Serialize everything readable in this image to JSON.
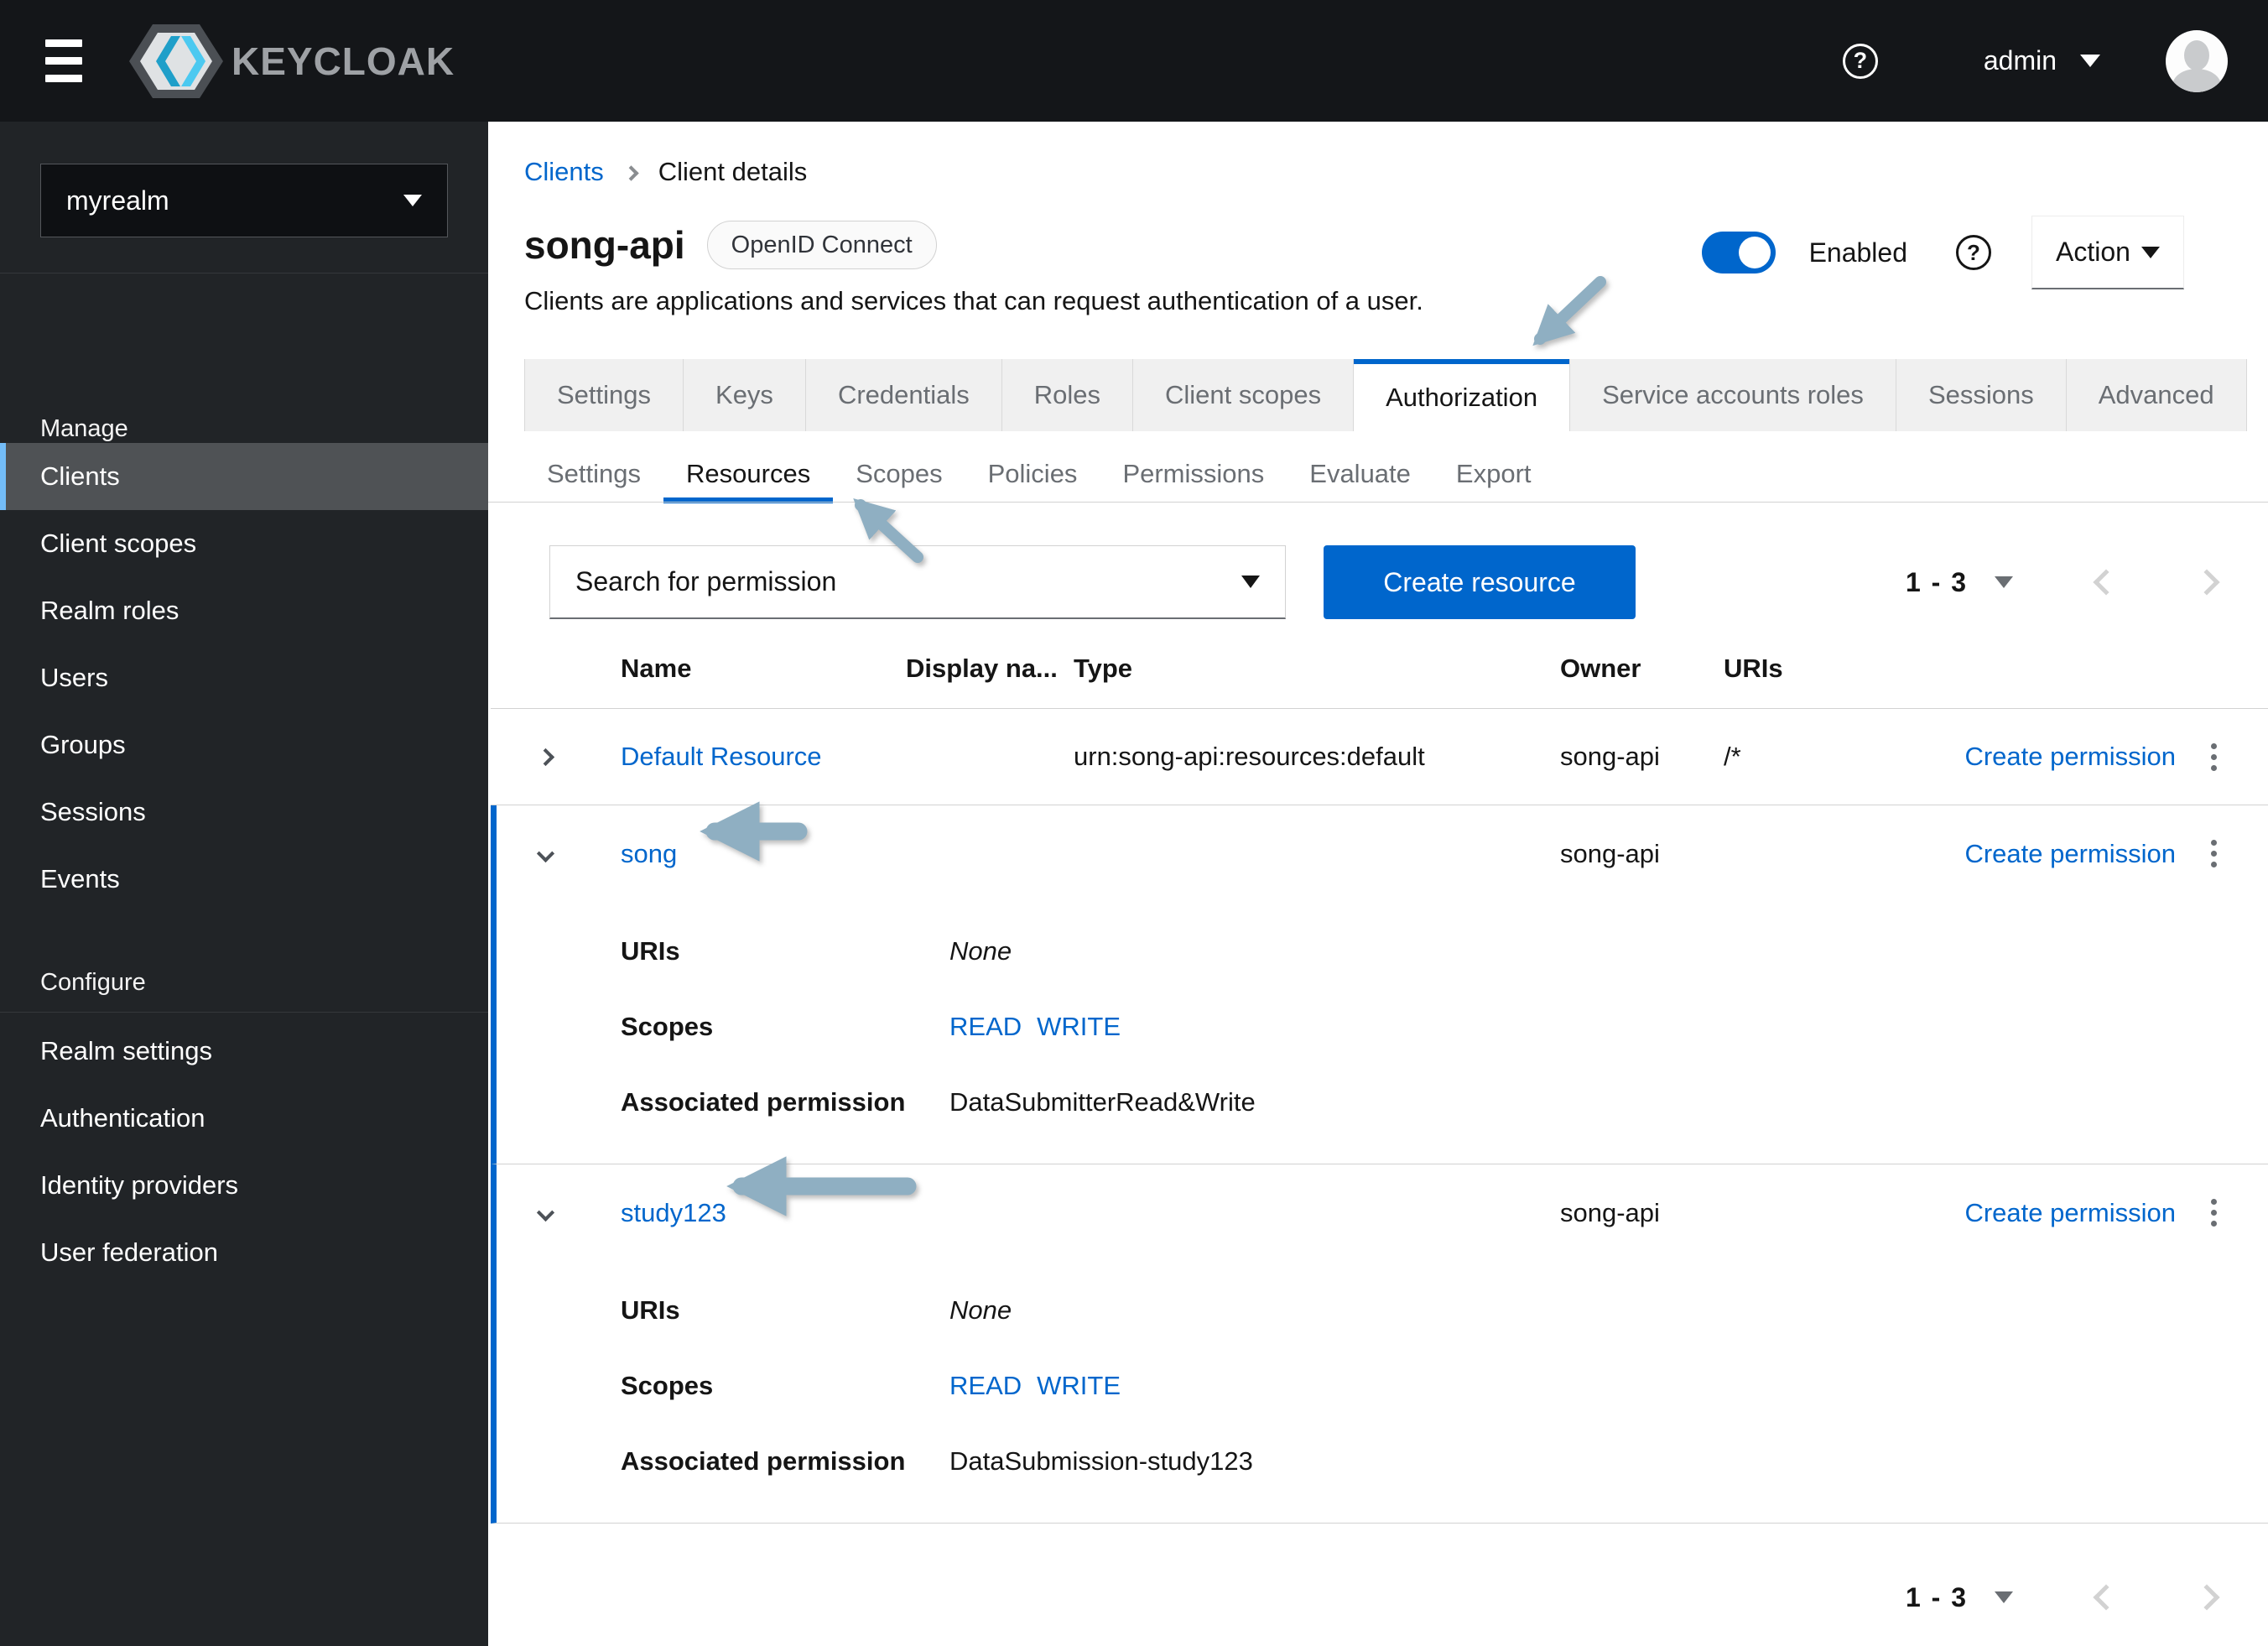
{
  "header": {
    "brand": "KEYCLOAK",
    "user": "admin",
    "help": "?"
  },
  "sidebar": {
    "realm": "myrealm",
    "manage_title": "Manage",
    "manage_items": [
      "Clients",
      "Client scopes",
      "Realm roles",
      "Users",
      "Groups",
      "Sessions",
      "Events"
    ],
    "active_item": "Clients",
    "configure_title": "Configure",
    "configure_items": [
      "Realm settings",
      "Authentication",
      "Identity providers",
      "User federation"
    ]
  },
  "breadcrumb": {
    "parent": "Clients",
    "current": "Client details"
  },
  "client": {
    "name": "song-api",
    "protocol_badge": "OpenID Connect",
    "description": "Clients are applications and services that can request authentication of a user.",
    "enabled_label": "Enabled",
    "action_label": "Action"
  },
  "tabs": {
    "items": [
      "Settings",
      "Keys",
      "Credentials",
      "Roles",
      "Client scopes",
      "Authorization",
      "Service accounts roles",
      "Sessions",
      "Advanced"
    ],
    "active": "Authorization"
  },
  "subtabs": {
    "items": [
      "Settings",
      "Resources",
      "Scopes",
      "Policies",
      "Permissions",
      "Evaluate",
      "Export"
    ],
    "active": "Resources"
  },
  "toolbar": {
    "search_placeholder": "Search for permission",
    "create_button": "Create resource"
  },
  "pagination": {
    "range": "1 - 3"
  },
  "table": {
    "columns": [
      "Name",
      "Display na...",
      "Type",
      "Owner",
      "URIs"
    ],
    "row_action": "Create permission",
    "detail_labels": {
      "uris": "URIs",
      "scopes": "Scopes",
      "permission": "Associated permission"
    },
    "rows": [
      {
        "name": "Default Resource",
        "type": "urn:song-api:resources:default",
        "owner": "song-api",
        "uris": "/*",
        "expanded": false
      },
      {
        "name": "song",
        "owner": "song-api",
        "expanded": true,
        "details": {
          "uris": "None",
          "scopes": [
            "READ",
            "WRITE"
          ],
          "permission": "DataSubmitterRead&Write"
        }
      },
      {
        "name": "study123",
        "owner": "song-api",
        "expanded": true,
        "details": {
          "uris": "None",
          "scopes": [
            "READ",
            "WRITE"
          ],
          "permission": "DataSubmission-study123"
        }
      }
    ]
  },
  "colors": {
    "accent": "#0066cc",
    "link": "#0066cc",
    "masthead": "#141619",
    "sidebar": "#212427",
    "annotation_arrow": "#8fafc2",
    "active_nav": "#4f5255",
    "active_nav_border": "#73bcf7"
  },
  "annotations": {
    "arrow_targets": [
      "authorization-tab",
      "resources-subtab",
      "song-row",
      "study123-row"
    ]
  }
}
